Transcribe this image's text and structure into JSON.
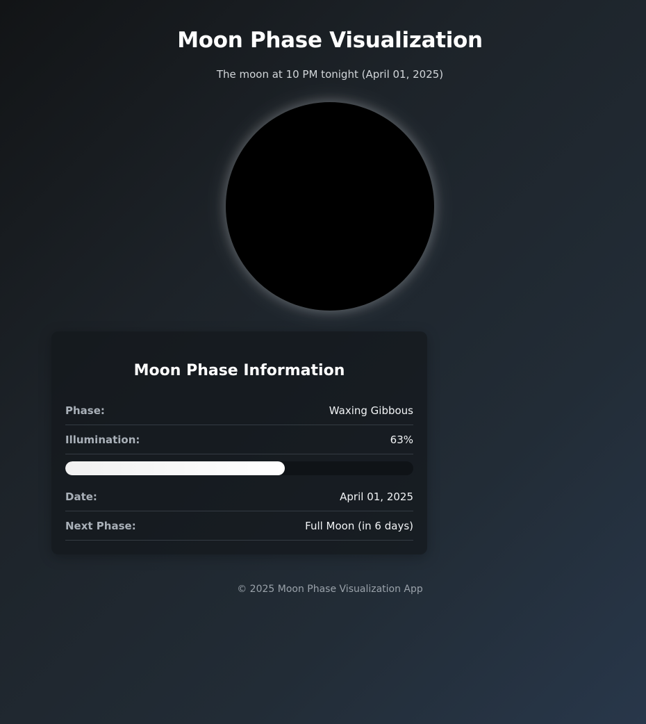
{
  "header": {
    "title": "Moon Phase Visualization",
    "subtitle": "The moon at 10 PM tonight (April 01, 2025)"
  },
  "moon": {
    "color": "#000000"
  },
  "info_card": {
    "title": "Moon Phase Information",
    "phase": {
      "label": "Phase:",
      "value": "Waxing Gibbous"
    },
    "illumination": {
      "label": "Illumination:",
      "value": "63%",
      "fraction": 0.63
    },
    "date": {
      "label": "Date:",
      "value": "April 01, 2025"
    },
    "next_phase": {
      "label": "Next Phase:",
      "value": "Full Moon (in 6 days)"
    }
  },
  "footer": {
    "text": "© 2025 Moon Phase Visualization App"
  }
}
